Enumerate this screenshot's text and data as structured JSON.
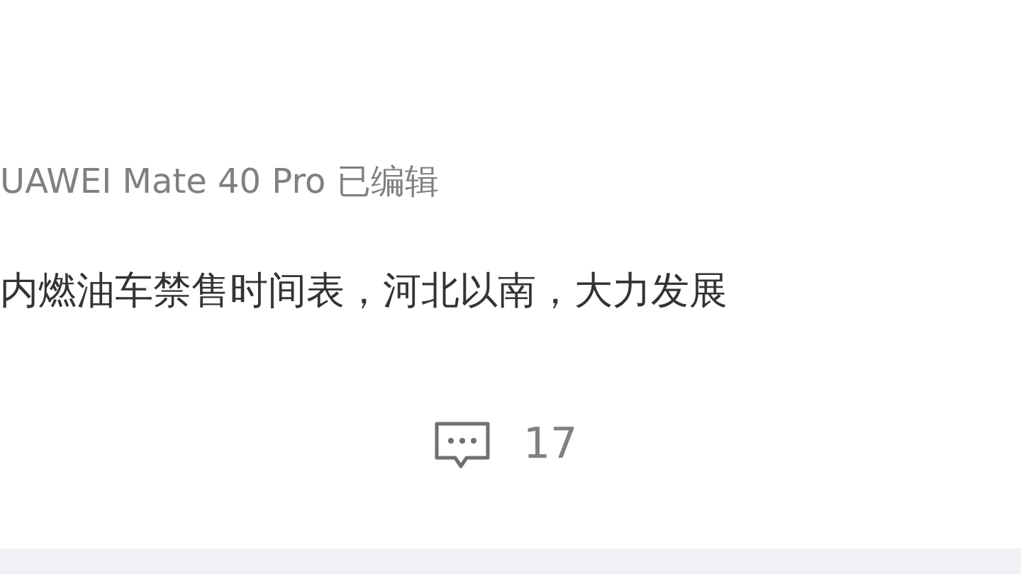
{
  "post": {
    "source": "UAWEI Mate 40 Pro 已编辑",
    "text": "内燃油车禁售时间表，河北以南，大力发展",
    "comment_count": "17"
  }
}
